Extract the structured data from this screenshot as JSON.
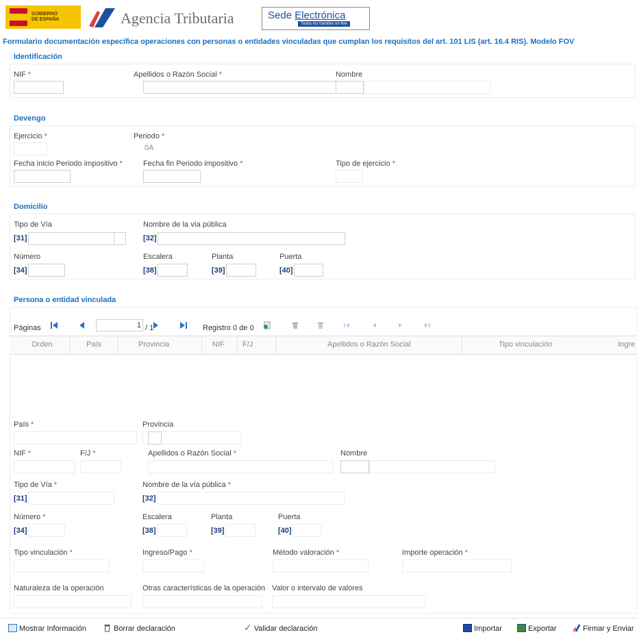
{
  "header": {
    "gobierno_line1": "GOBIERNO",
    "gobierno_line2": "DE ESPAÑA",
    "agency_name": "Agencia Tributaria",
    "sede_word1": "Sede",
    "sede_word2": "Electrónica",
    "sede_tagline": "Todos los trámites on line"
  },
  "form_title": "Formulario documentación específica operaciones con personas o entidades vinculadas que cumplan los requisitos del art. 101 LIS (art. 16.4 RIS). Modelo FOV",
  "identificacion": {
    "title": "Identificación",
    "nif_label": "NIF",
    "apellidos_label": "Apellidos o Razón Social",
    "nombre_label": "Nombre"
  },
  "devengo": {
    "title": "Devengo",
    "ejercicio_label": "Ejercicio",
    "periodo_label": "Periodo",
    "periodo_value": "0A",
    "fecha_inicio_label": "Fecha inicio Periodo impositivo",
    "fecha_fin_label": "Fecha fin Periodo impositivo",
    "tipo_ejercicio_label": "Tipo de ejercicio"
  },
  "domicilio": {
    "title": "Domicilio",
    "tipo_via_label": "Tipo de Vía",
    "nombre_via_label": "Nombre de la vía pública",
    "code_31": "[31]",
    "code_32": "[32]",
    "numero_label": "Número",
    "escalera_label": "Escalera",
    "planta_label": "Planta",
    "puerta_label": "Puerta",
    "code_34": "[34]",
    "code_38": "[38]",
    "code_39": "[39]",
    "code_40": "[40]"
  },
  "vinculada": {
    "title": "Persona o entidad vinculada",
    "paginas_label": "Páginas",
    "page_current": "1",
    "page_total": "/ 1",
    "registro_text": "Registro 0 de 0",
    "columns": [
      "Orden",
      "País",
      "Provincia",
      "NIF",
      "F/J",
      "Apellidos o Razón Social",
      "Tipo vinculación",
      "Ingre"
    ],
    "pais_label": "País",
    "provincia_label": "Provincia",
    "nif_label": "NIF",
    "fj_label": "F/J",
    "apellidos_label": "Apellidos o Razón Social",
    "nombre_label": "Nombre",
    "tipo_via_label": "Tipo de Vía",
    "nombre_via_label": "Nombre de la vía pública",
    "code_31": "[31]",
    "code_32": "[32]",
    "numero_label": "Número",
    "escalera_label": "Escalera",
    "planta_label": "Planta",
    "puerta_label": "Puerta",
    "code_34": "[34]",
    "code_38": "[38]",
    "code_39": "[39]",
    "code_40": "[40]",
    "tipo_vinculacion_label": "Tipo vinculación",
    "ingreso_pago_label": "Ingreso/Pago",
    "metodo_label": "Método valoración",
    "importe_label": "Importe operación",
    "naturaleza_label": "Naturaleza de la operación",
    "otras_label": "Otras características de la operación",
    "valor_label": "Valor o intervalo de valores"
  },
  "bottom_bar": {
    "mostrar": "Mostrar Información",
    "borrar": "Borrar declaración",
    "validar": "Validar declaración",
    "importar": "Importar",
    "exportar": "Exportar",
    "firmar": "Firmar y Enviar"
  },
  "colors": {
    "accent": "#1b6fbf",
    "required": "#e23c3c",
    "code": "#1a3d7a",
    "validate_green": "#2e9b2e"
  },
  "icons": {
    "first": "first-page-icon",
    "prev": "prev-page-icon",
    "next": "next-page-icon",
    "last": "last-page-icon",
    "add": "add-record-icon",
    "delete": "delete-record-icon",
    "delete_all": "delete-all-icon"
  }
}
